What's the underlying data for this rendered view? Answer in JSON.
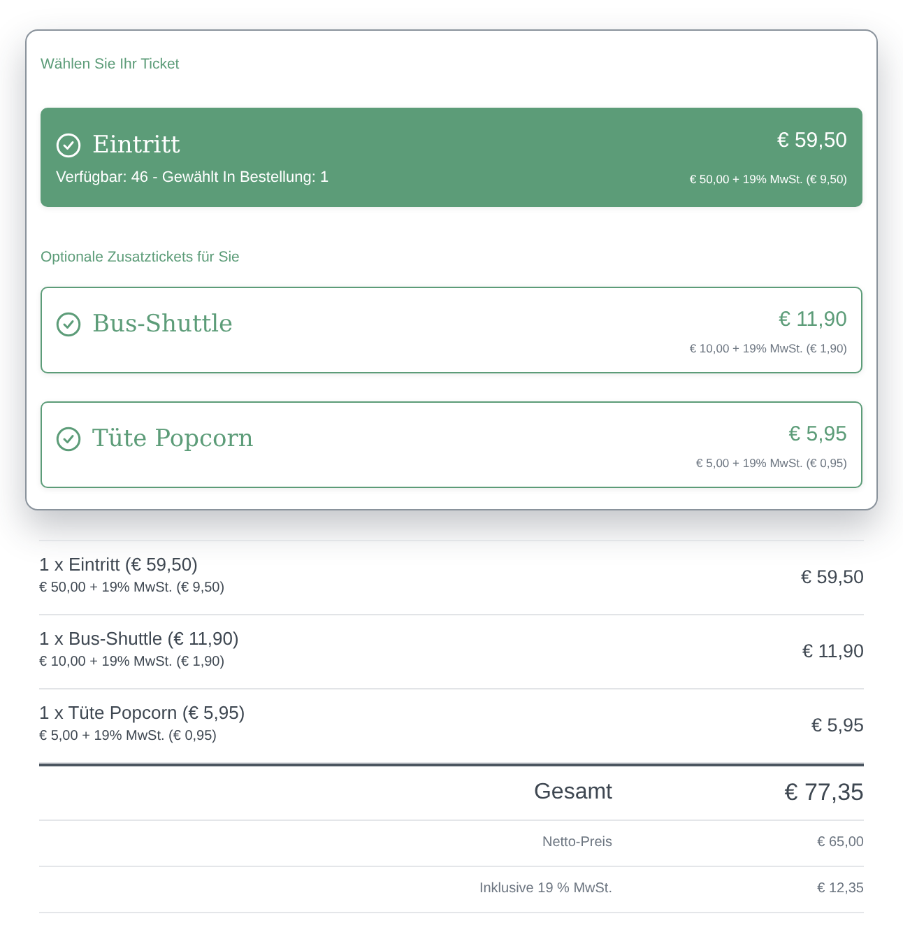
{
  "ticket_panel": {
    "sections": [
      {
        "heading": "Wählen Sie Ihr Ticket",
        "tickets": [
          {
            "name": "Eintritt",
            "price": "€ 59,50",
            "availability": "Verfügbar: 46 - Gewählt In Bestellung: 1",
            "tax_note": "€ 50,00 + 19% MwSt. (€ 9,50)",
            "selected": true
          }
        ]
      },
      {
        "heading": "Optionale Zusatztickets für Sie",
        "tickets": [
          {
            "name": "Bus-Shuttle",
            "price": "€ 11,90",
            "tax_note": "€ 10,00 + 19% MwSt. (€ 1,90)",
            "selected": false
          },
          {
            "name": "Tüte Popcorn",
            "price": "€ 5,95",
            "tax_note": "€ 5,00 + 19% MwSt. (€ 0,95)",
            "selected": false
          }
        ]
      }
    ]
  },
  "order_lines": [
    {
      "title": "1 x Eintritt (€ 59,50)",
      "tax_note": "€ 50,00 + 19% MwSt. (€ 9,50)",
      "total": "€ 59,50"
    },
    {
      "title": "1 x Bus-Shuttle (€ 11,90)",
      "tax_note": "€ 10,00 + 19% MwSt. (€ 1,90)",
      "total": "€ 11,90"
    },
    {
      "title": "1 x Tüte Popcorn (€ 5,95)",
      "tax_note": "€ 5,00 + 19% MwSt. (€ 0,95)",
      "total": "€ 5,95"
    }
  ],
  "totals": [
    {
      "kind": "grand",
      "label": "Gesamt",
      "value": "€ 77,35"
    },
    {
      "kind": "sub",
      "label": "Netto-Preis",
      "value": "€ 65,00"
    },
    {
      "kind": "sub",
      "label": "Inklusive 19 % MwSt.",
      "value": "€ 12,35"
    }
  ]
}
